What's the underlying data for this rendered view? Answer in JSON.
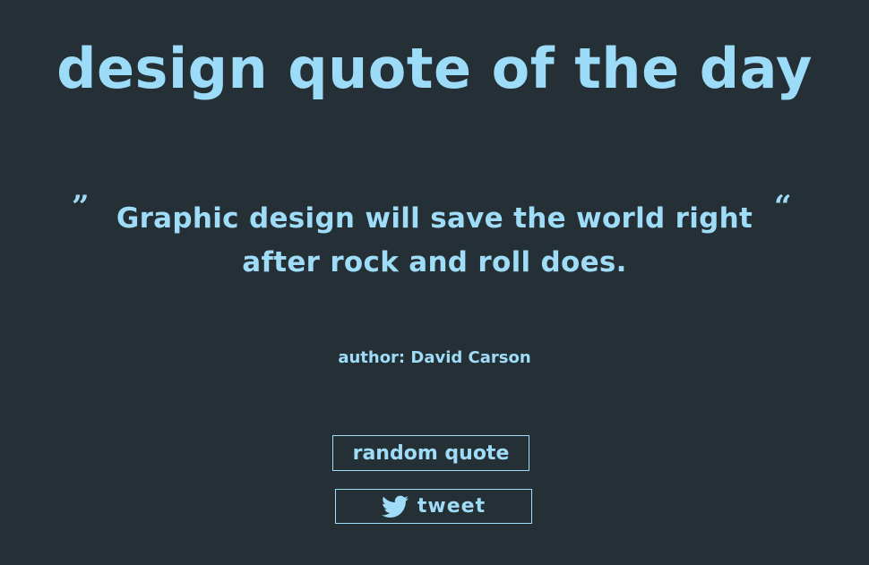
{
  "header": {
    "title": "design quote of the day"
  },
  "quote": {
    "open_mark": "”",
    "close_mark": "“",
    "text": "Graphic design will save the world right after rock and roll does.",
    "author_label": "author: David Carson"
  },
  "actions": {
    "random_label": "random quote",
    "tweet_label": "tweet",
    "tweet_icon": "twitter-bird-icon"
  },
  "colors": {
    "background": "#253036",
    "accent": "#9fdcf7"
  }
}
